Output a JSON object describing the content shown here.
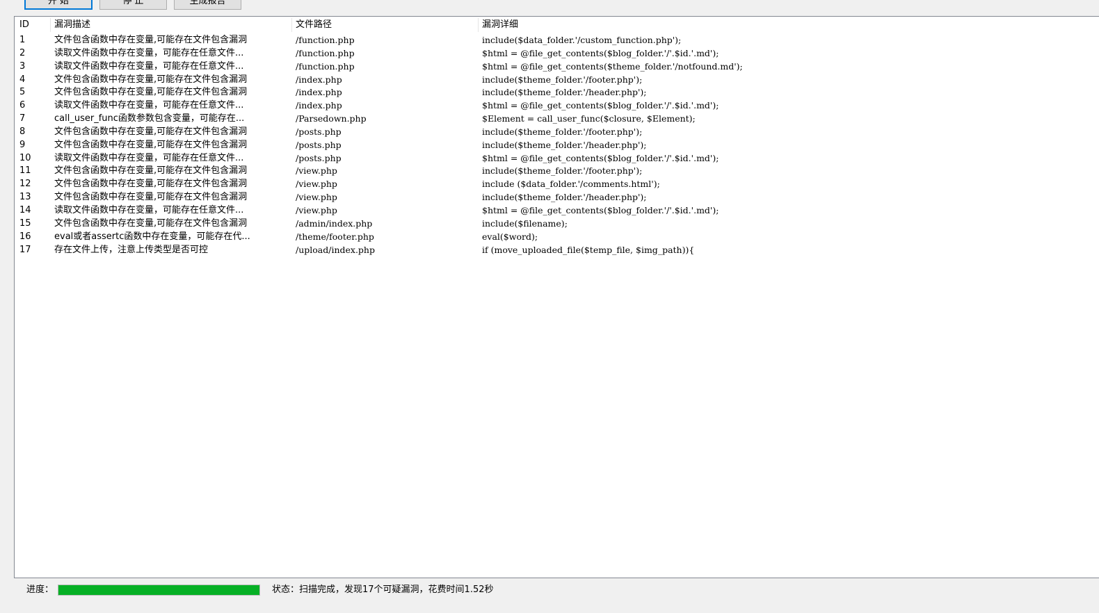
{
  "toolbar": {
    "start_label": "开 始",
    "stop_label": "停 止",
    "report_label": "生成报告"
  },
  "table": {
    "columns": [
      "ID",
      "漏洞描述",
      "文件路径",
      "漏洞详细"
    ],
    "rows": [
      {
        "id": "1",
        "desc": "文件包含函数中存在变量,可能存在文件包含漏洞",
        "path": "/function.php",
        "detail": "include($data_folder.'/custom_function.php');"
      },
      {
        "id": "2",
        "desc": "读取文件函数中存在变量，可能存在任意文件...",
        "path": "/function.php",
        "detail": "$html = @file_get_contents($blog_folder.'/'.$id.'.md');"
      },
      {
        "id": "3",
        "desc": "读取文件函数中存在变量，可能存在任意文件...",
        "path": "/function.php",
        "detail": "$html = @file_get_contents($theme_folder.'/notfound.md');"
      },
      {
        "id": "4",
        "desc": "文件包含函数中存在变量,可能存在文件包含漏洞",
        "path": "/index.php",
        "detail": "include($theme_folder.'/footer.php');"
      },
      {
        "id": "5",
        "desc": "文件包含函数中存在变量,可能存在文件包含漏洞",
        "path": "/index.php",
        "detail": "include($theme_folder.'/header.php');"
      },
      {
        "id": "6",
        "desc": "读取文件函数中存在变量，可能存在任意文件...",
        "path": "/index.php",
        "detail": "$html = @file_get_contents($blog_folder.'/'.$id.'.md');"
      },
      {
        "id": "7",
        "desc": "call_user_func函数参数包含变量，可能存在...",
        "path": "/Parsedown.php",
        "detail": "$Element = call_user_func($closure, $Element);"
      },
      {
        "id": "8",
        "desc": "文件包含函数中存在变量,可能存在文件包含漏洞",
        "path": "/posts.php",
        "detail": "include($theme_folder.'/footer.php');"
      },
      {
        "id": "9",
        "desc": "文件包含函数中存在变量,可能存在文件包含漏洞",
        "path": "/posts.php",
        "detail": "include($theme_folder.'/header.php');"
      },
      {
        "id": "10",
        "desc": "读取文件函数中存在变量，可能存在任意文件...",
        "path": "/posts.php",
        "detail": "$html = @file_get_contents($blog_folder.'/'.$id.'.md');"
      },
      {
        "id": "11",
        "desc": "文件包含函数中存在变量,可能存在文件包含漏洞",
        "path": "/view.php",
        "detail": "include($theme_folder.'/footer.php');"
      },
      {
        "id": "12",
        "desc": "文件包含函数中存在变量,可能存在文件包含漏洞",
        "path": "/view.php",
        "detail": "include ($data_folder.'/comments.html');"
      },
      {
        "id": "13",
        "desc": "文件包含函数中存在变量,可能存在文件包含漏洞",
        "path": "/view.php",
        "detail": "include($theme_folder.'/header.php');"
      },
      {
        "id": "14",
        "desc": "读取文件函数中存在变量，可能存在任意文件...",
        "path": "/view.php",
        "detail": "$html = @file_get_contents($blog_folder.'/'.$id.'.md');"
      },
      {
        "id": "15",
        "desc": "文件包含函数中存在变量,可能存在文件包含漏洞",
        "path": "/admin/index.php",
        "detail": "include($filename);"
      },
      {
        "id": "16",
        "desc": "eval或者assertc函数中存在变量，可能存在代...",
        "path": "/theme/footer.php",
        "detail": "eval($word);"
      },
      {
        "id": "17",
        "desc": "存在文件上传，注意上传类型是否可控",
        "path": "/upload/index.php",
        "detail": "if (move_uploaded_file($temp_file, $img_path)){"
      }
    ]
  },
  "status": {
    "progress_label": "进度：",
    "progress_value": 1.0,
    "progress_color": "#06b025",
    "status_text": "状态：扫描完成，发现17个可疑漏洞，花费时间1.52秒"
  }
}
